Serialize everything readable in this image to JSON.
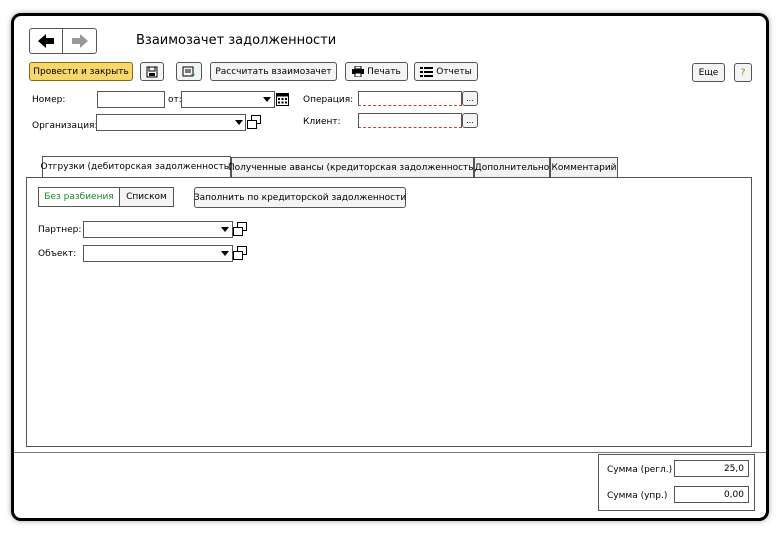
{
  "window": {
    "title": "Взаимозачет задолженности"
  },
  "nav": {
    "back_icon": "arrow-left-icon",
    "forward_icon": "arrow-right-icon"
  },
  "toolbar": {
    "post_close_label": "Провести и закрыть",
    "calc_label": "Рассчитать взаимозачет",
    "print_label": "Печать",
    "reports_label": "Отчеты",
    "more_label": "Еще",
    "help_label": "?"
  },
  "form": {
    "number_label": "Номер:",
    "number_value": "",
    "date_label": "от:",
    "date_value": "",
    "org_label": "Организация:",
    "org_value": "",
    "operation_label": "Операция:",
    "operation_value": "",
    "client_label": "Клиент:",
    "client_value": "",
    "ellipsis": "..."
  },
  "tabs": [
    {
      "label": "Отгрузки (дебиторская задолженность)"
    },
    {
      "label": "Полученные авансы (кредиторская задолженность)"
    },
    {
      "label": "Дополнительно"
    },
    {
      "label": "Комментарий"
    }
  ],
  "panel": {
    "toggle_nosplit": "Без разбиения",
    "toggle_list": "Списком",
    "fill_label": "Заполнить по кредиторской задолженности",
    "partner_label": "Партнер:",
    "partner_value": "",
    "object_label": "Объект:",
    "object_value": ""
  },
  "totals": {
    "sum_reg_label": "Сумма (регл.)",
    "sum_reg_value": "25,0",
    "sum_mgmt_label": "Сумма (упр.)",
    "sum_mgmt_value": "0,00"
  },
  "colors": {
    "primary_button": "#f8d76a",
    "toggle_active_text": "#1a8a2a",
    "required_underline": "#dd3333"
  }
}
